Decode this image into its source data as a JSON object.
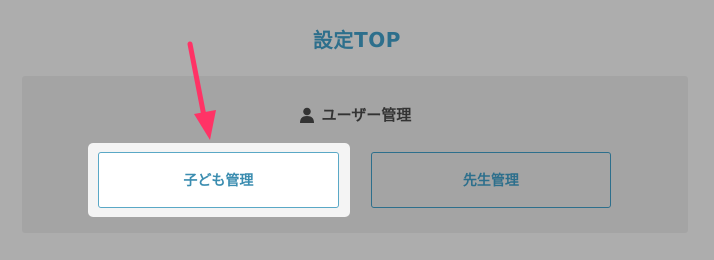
{
  "page": {
    "title": "設定TOP"
  },
  "user_management": {
    "heading": "ユーザー管理",
    "icon": "user-icon",
    "buttons": {
      "children_label": "子ども管理",
      "teachers_label": "先生管理"
    }
  },
  "annotation": {
    "icon": "arrow-pointer-icon",
    "color": "#ff3366"
  },
  "colors": {
    "background": "#adadad",
    "title": "#2d6f8c",
    "highlight": "#f4f4f4",
    "accent_arrow": "#ff3366"
  }
}
